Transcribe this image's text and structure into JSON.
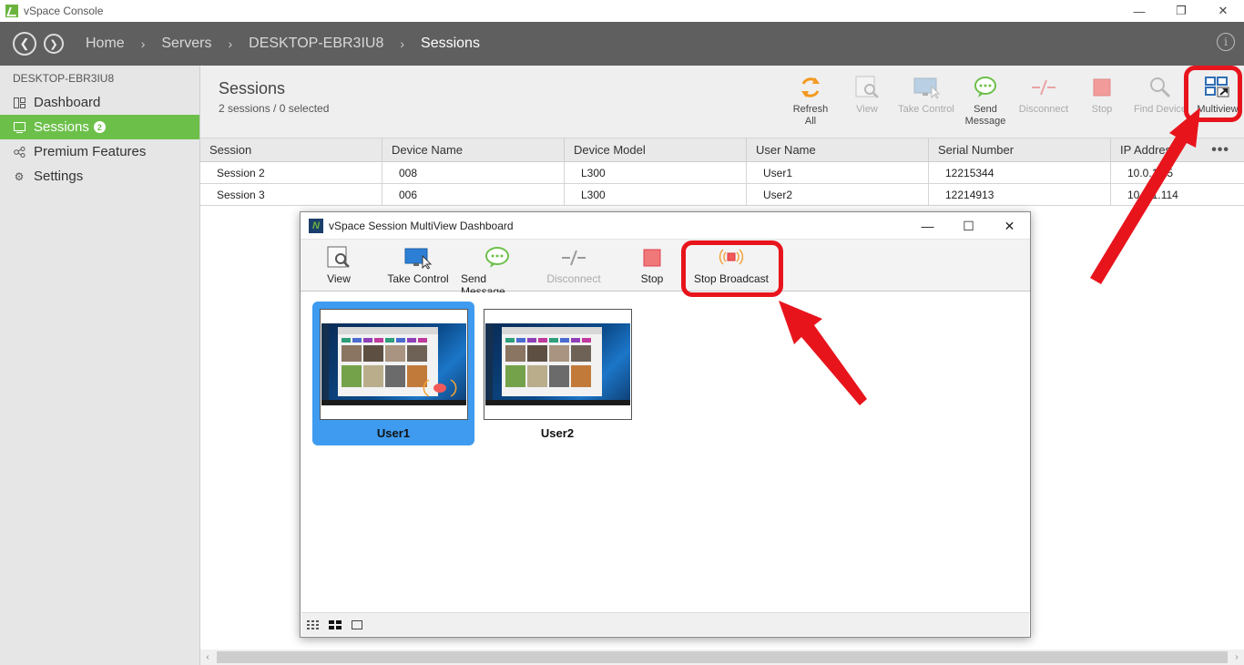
{
  "window": {
    "title": "vSpace Console",
    "controls": [
      "—",
      "❐",
      "✕"
    ]
  },
  "breadcrumb": [
    "Home",
    "Servers",
    "DESKTOP-EBR3IU8",
    "Sessions"
  ],
  "sidebar": {
    "host": "DESKTOP-EBR3IU8",
    "items": [
      {
        "label": "Dashboard",
        "icon": "dashboard-icon",
        "active": false
      },
      {
        "label": "Sessions",
        "icon": "sessions-icon",
        "active": true,
        "badge": "2"
      },
      {
        "label": "Premium Features",
        "icon": "premium-icon",
        "active": false
      },
      {
        "label": "Settings",
        "icon": "gear-icon",
        "active": false
      }
    ]
  },
  "main": {
    "title": "Sessions",
    "subtitle": "2  sessions  /  0  selected",
    "toolbar": [
      {
        "label": "Refresh All",
        "line1": "Refresh",
        "line2": "All",
        "icon": "refresh-icon",
        "enabled": true
      },
      {
        "label": "View",
        "line1": "View",
        "line2": "",
        "icon": "view-icon",
        "enabled": false
      },
      {
        "label": "Take Control",
        "line1": "Take Control",
        "line2": "",
        "icon": "take-control-icon",
        "enabled": false
      },
      {
        "label": "Send Message",
        "line1": "Send",
        "line2": "Message",
        "icon": "message-icon",
        "enabled": true
      },
      {
        "label": "Disconnect",
        "line1": "Disconnect",
        "line2": "",
        "icon": "disconnect-icon",
        "enabled": false
      },
      {
        "label": "Stop",
        "line1": "Stop",
        "line2": "",
        "icon": "stop-icon",
        "enabled": false
      },
      {
        "label": "Find Device",
        "line1": "Find Device",
        "line2": "",
        "icon": "find-icon",
        "enabled": false
      },
      {
        "label": "Multiview",
        "line1": "Multiview",
        "line2": "",
        "icon": "multiview-icon",
        "enabled": true
      }
    ],
    "table": {
      "columns": [
        "Session",
        "Device Name",
        "Device Model",
        "User Name",
        "Serial Number",
        "IP Address"
      ],
      "more": "•••",
      "rows": [
        [
          "Session 2",
          "008",
          "L300",
          "User1",
          "12215344",
          "10.0.1.15"
        ],
        [
          "Session 3",
          "006",
          "L300",
          "User2",
          "12214913",
          "10.0.1.114"
        ]
      ]
    }
  },
  "dialog": {
    "title": "vSpace Session MultiView Dashboard",
    "controls": [
      "—",
      "☐",
      "✕"
    ],
    "toolbar": [
      {
        "label": "View",
        "icon": "view-icon",
        "enabled": true
      },
      {
        "label": "Take Control",
        "icon": "take-control-icon",
        "enabled": true
      },
      {
        "label": "Send Message",
        "icon": "message-icon",
        "enabled": true
      },
      {
        "label": "Disconnect",
        "icon": "disconnect-icon",
        "enabled": false
      },
      {
        "label": "Stop",
        "icon": "stop-icon",
        "enabled": true
      },
      {
        "label": "Stop Broadcast",
        "icon": "stop-broadcast-icon",
        "enabled": true
      }
    ],
    "tiles": [
      {
        "label": "User1",
        "selected": true,
        "broadcasting": true
      },
      {
        "label": "User2",
        "selected": false,
        "broadcasting": false
      }
    ],
    "view_modes": [
      "grid-small-icon",
      "grid-medium-icon",
      "single-view-icon"
    ]
  },
  "colors": {
    "accent_green": "#6cc04a",
    "highlight_red": "#e8141c",
    "selected_blue": "#3e9bef",
    "nav_bg": "#5f5f5f"
  }
}
